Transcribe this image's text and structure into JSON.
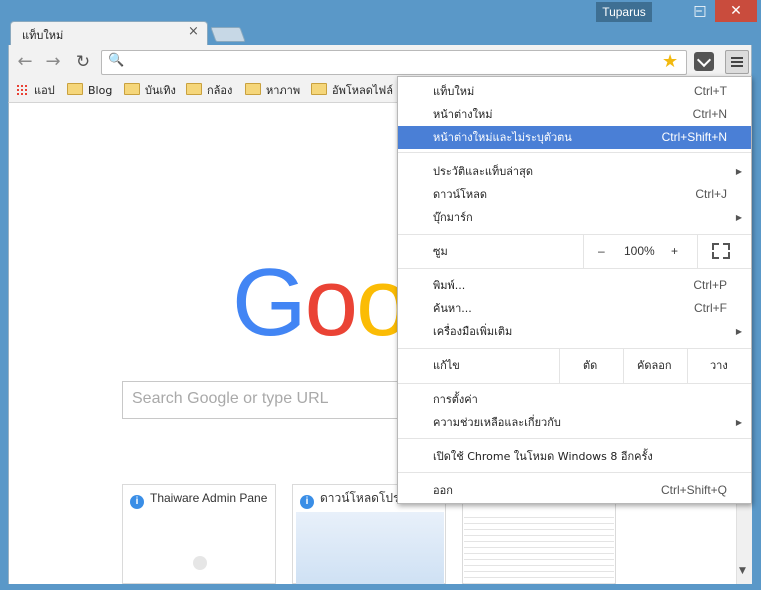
{
  "window": {
    "user_badge": "Tuparus",
    "min_glyph": "–",
    "max_glyph": "□",
    "close_glyph": "✕"
  },
  "tab": {
    "title": "แท็บใหม่",
    "close_glyph": "×"
  },
  "toolbar": {
    "back_glyph": "←",
    "forward_glyph": "→",
    "reload_glyph": "↻",
    "search_glyph": "🔍",
    "star_glyph": "★",
    "omnibox_value": ""
  },
  "bookmarks": {
    "apps": "แอป",
    "items": [
      "Blog",
      "บันเทิง",
      "กล้อง",
      "หาภาพ",
      "อัพโหลดไฟล์"
    ]
  },
  "newtab": {
    "logo": [
      "G",
      "o",
      "o"
    ],
    "logo_colors": [
      "#4285f4",
      "#ea4335",
      "#fbbc05"
    ],
    "search_placeholder": "Search Google or type URL",
    "thumbnails": [
      "Thaiware Admin Pane",
      "ดาวน์โหลดโปร"
    ],
    "info_glyph": "i"
  },
  "menu": {
    "items": [
      {
        "label": "แท็บใหม่",
        "shortcut": "Ctrl+T"
      },
      {
        "label": "หน้าต่างใหม่",
        "shortcut": "Ctrl+N"
      },
      {
        "label": "หน้าต่างใหม่และไม่ระบุตัวตน",
        "shortcut": "Ctrl+Shift+N"
      },
      {
        "label": "ประวัติและแท็บล่าสุด",
        "shortcut": ""
      },
      {
        "label": "ดาวน์โหลด",
        "shortcut": "Ctrl+J"
      },
      {
        "label": "บุ๊กมาร์ก",
        "shortcut": ""
      },
      {
        "label": "พิมพ์...",
        "shortcut": "Ctrl+P"
      },
      {
        "label": "ค้นหา...",
        "shortcut": "Ctrl+F"
      },
      {
        "label": "เครื่องมือเพิ่มเติม",
        "shortcut": ""
      },
      {
        "label": "การตั้งค่า",
        "shortcut": ""
      },
      {
        "label": "ความช่วยเหลือและเกี่ยวกับ",
        "shortcut": ""
      },
      {
        "label": "เปิดใช้ Chrome ในโหมด Windows 8 อีกครั้ง",
        "shortcut": ""
      },
      {
        "label": "ออก",
        "shortcut": "Ctrl+Shift+Q"
      }
    ],
    "zoom": {
      "label": "ซูม",
      "minus": "–",
      "value": "100%",
      "plus": "+"
    },
    "edit": {
      "label": "แก้ไข",
      "cut": "ตัด",
      "copy": "คัดลอก",
      "paste": "วาง"
    },
    "submenu_arrow": "▶",
    "highlight_color": "#4a7fd6"
  }
}
